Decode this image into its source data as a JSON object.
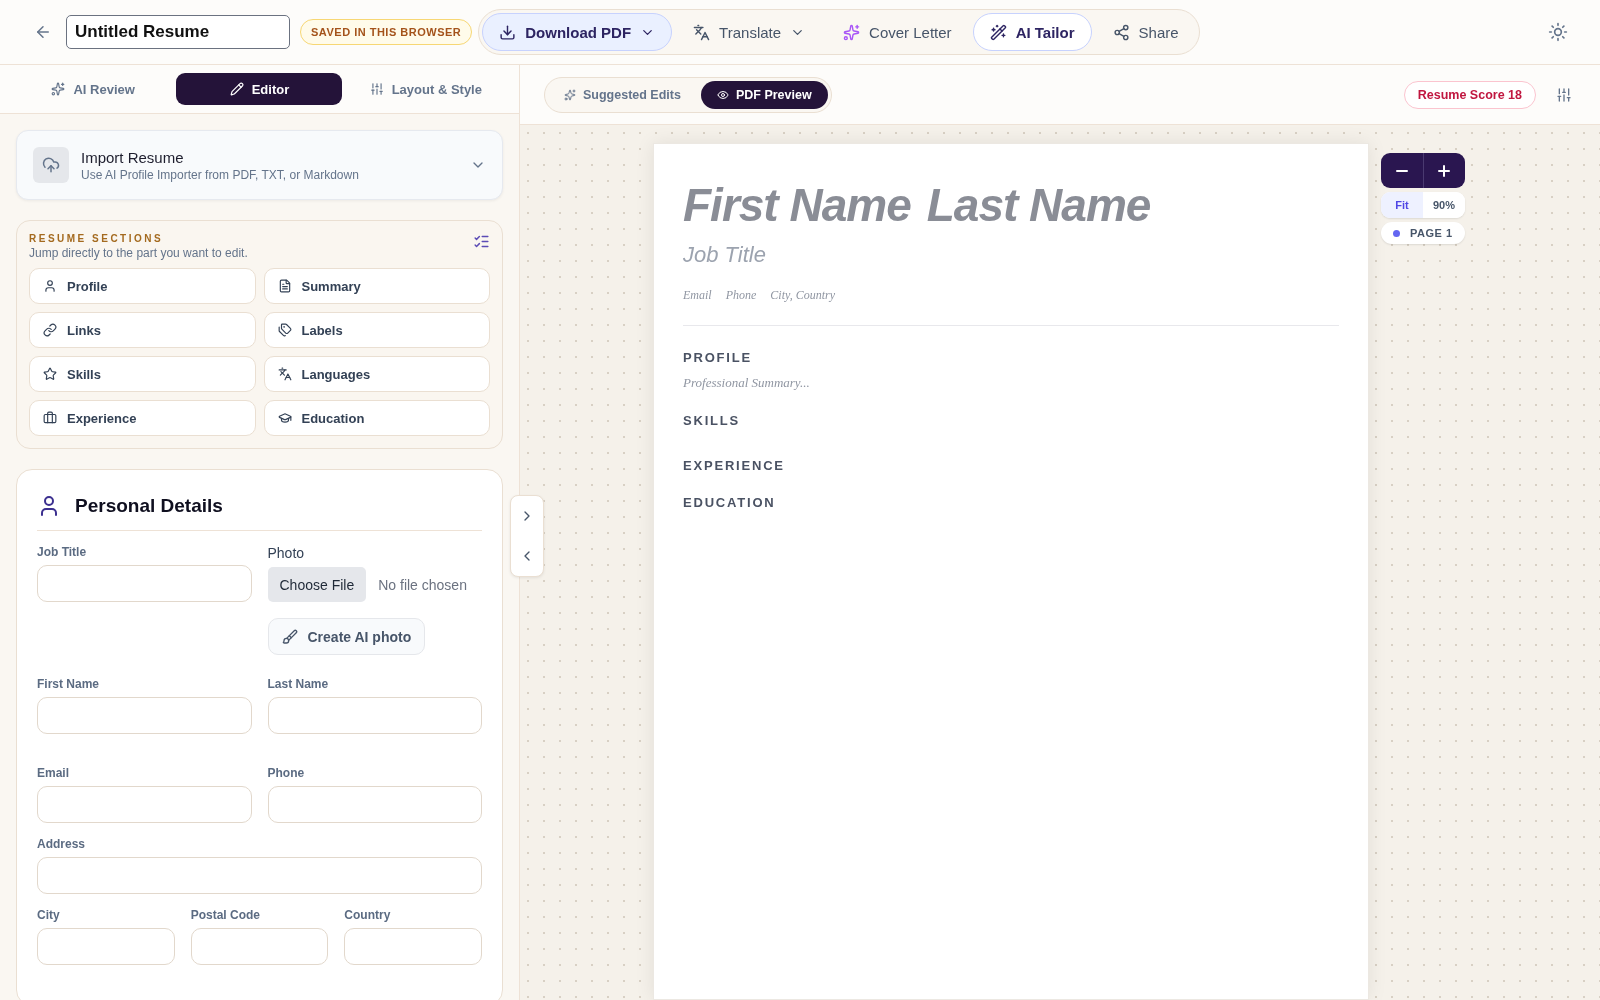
{
  "header": {
    "document_title": "Untitled Resume",
    "save_badge": "SAVED IN THIS BROWSER",
    "actions": [
      {
        "label": "Download PDF",
        "kind": "primary",
        "dropdown": true
      },
      {
        "label": "Translate",
        "kind": "plain",
        "dropdown": true
      },
      {
        "label": "Cover Letter",
        "kind": "plain",
        "dropdown": false
      },
      {
        "label": "AI Tailor",
        "kind": "outline",
        "dropdown": false
      },
      {
        "label": "Share",
        "kind": "plain",
        "dropdown": false
      }
    ]
  },
  "editor_tabs": [
    {
      "label": "AI Review",
      "selected": false
    },
    {
      "label": "Editor",
      "selected": true
    },
    {
      "label": "Layout & Style",
      "selected": false
    }
  ],
  "import_card": {
    "title": "Import Resume",
    "subtitle": "Use AI Profile Importer from PDF, TXT, or Markdown",
    "expanded": false
  },
  "sections_card": {
    "heading": "RESUME SECTIONS",
    "description": "Jump directly to the part you want to edit.",
    "items": [
      {
        "label": "Profile"
      },
      {
        "label": "Summary"
      },
      {
        "label": "Links"
      },
      {
        "label": "Labels"
      },
      {
        "label": "Skills"
      },
      {
        "label": "Languages"
      },
      {
        "label": "Experience"
      },
      {
        "label": "Education"
      }
    ]
  },
  "personal_details": {
    "title": "Personal Details",
    "job_title_label": "Job Title",
    "photo": {
      "label": "Photo",
      "choose_button": "Choose File",
      "status": "No file chosen",
      "ai_button": "Create AI photo"
    },
    "rows": [
      [
        {
          "label": "First Name"
        },
        {
          "label": "Last Name"
        }
      ],
      [
        {
          "label": "Email"
        },
        {
          "label": "Phone"
        }
      ],
      [
        {
          "label": "Address"
        }
      ],
      [
        {
          "label": "City"
        },
        {
          "label": "Postal Code"
        },
        {
          "label": "Country"
        }
      ]
    ]
  },
  "preview_toolbar": {
    "tabs": [
      {
        "label": "Suggested Edits",
        "selected": false
      },
      {
        "label": "PDF Preview",
        "selected": true
      }
    ],
    "score": "Resume Score 18"
  },
  "resume": {
    "first_name": "First Name",
    "last_name": "Last Name",
    "job_title": "Job Title",
    "contacts": [
      "Email",
      "Phone",
      "City, Country"
    ],
    "sections": [
      {
        "heading": "PROFILE",
        "text": "Professional Summary..."
      },
      {
        "heading": "SKILLS"
      },
      {
        "heading": "EXPERIENCE"
      },
      {
        "heading": "EDUCATION"
      }
    ]
  },
  "zoom": {
    "modes": [
      {
        "label": "Fit",
        "selected": true
      },
      {
        "label": "90%",
        "selected": false
      }
    ],
    "page": "PAGE 1"
  }
}
